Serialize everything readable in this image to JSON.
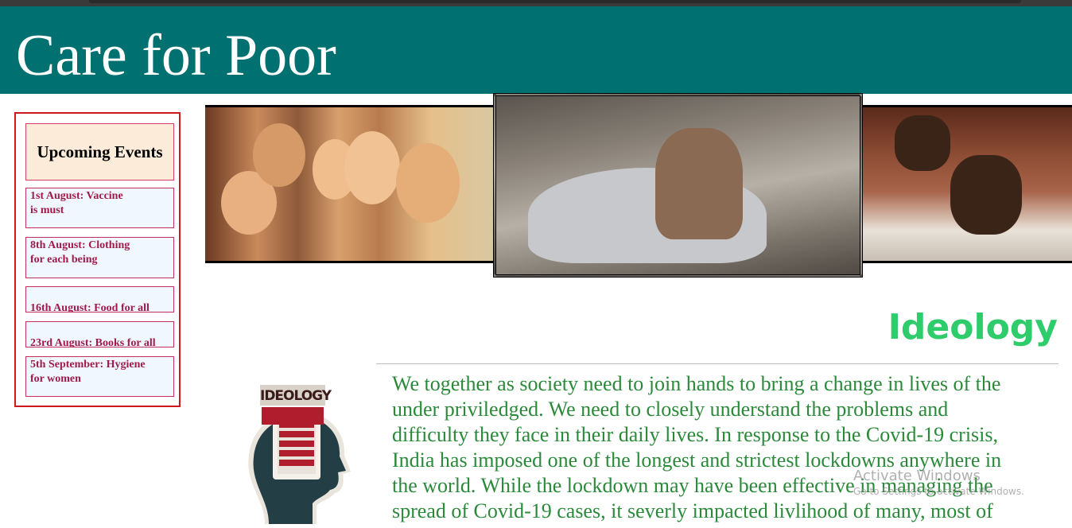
{
  "header": {
    "title": "Care for Poor"
  },
  "events": {
    "heading": "Upcoming Events",
    "items": [
      {
        "line1": "1st August: Vaccine",
        "line2": "is must"
      },
      {
        "line1": "8th August: Clothing",
        "line2": "for each being"
      },
      {
        "line1": "16th August: Food for all",
        "line2": ""
      },
      {
        "line1": "23rd August: Books for all",
        "line2": ""
      },
      {
        "line1": "5th September: Hygiene",
        "line2": "for women"
      }
    ]
  },
  "gallery": {
    "images": [
      {
        "alt": "children smiling"
      },
      {
        "alt": "poor children sleeping on bags"
      },
      {
        "alt": "children studying on floor"
      }
    ]
  },
  "ideology": {
    "title": "Ideology",
    "logo_text": "IDEOLOGY",
    "paragraph_lines": [
      "We together as society need to join hands to bring a change in lives of the",
      "under priviledged. We need to closely understand the problems and",
      "difficulty they face in their daily lives. In response to the Covid-19 crisis,",
      "India has imposed one of the longest and strictest lockdowns anywhere in",
      "the world. While the lockdown may have been effective in managing the",
      "spread of Covid-19 cases, it severly impacted livlihood of many, most of"
    ]
  },
  "watermark": {
    "title": "Activate Windows",
    "subtitle": "Go to Settings to activate Windows."
  },
  "colors": {
    "header_bg": "#007070",
    "event_border": "#d01a1a",
    "event_text": "#a11a4a",
    "ideology_title": "#2ecc6b",
    "paragraph_text": "#2a8a3a"
  }
}
